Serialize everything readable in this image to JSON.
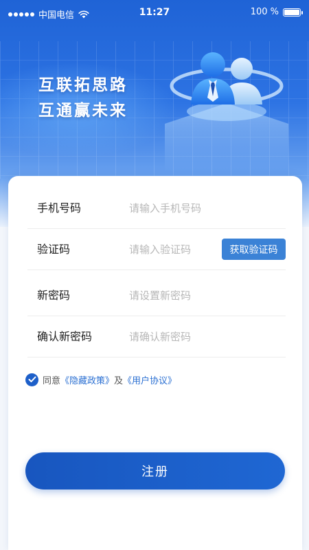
{
  "status_bar": {
    "carrier": "中国电信",
    "time": "11:27",
    "battery": "100 %"
  },
  "banner": {
    "line1": "互联拓思路",
    "line2": "互通赢未来"
  },
  "form": {
    "phone": {
      "label": "手机号码",
      "placeholder": "请输入手机号码"
    },
    "code": {
      "label": "验证码",
      "placeholder": "请输入验证码",
      "button": "获取验证码"
    },
    "password": {
      "label": "新密码",
      "placeholder": "请设置新密码"
    },
    "confirm": {
      "label": "确认新密码",
      "placeholder": "请确认新密码"
    }
  },
  "agreement": {
    "checked": true,
    "prefix": "同意",
    "privacy": "《隐藏政策》",
    "conj": "及",
    "terms": "《用户协议》"
  },
  "submit_label": "注册",
  "colors": {
    "primary": "#1d5fc9",
    "accent_button": "#3b82d6",
    "link": "#2a6fd2"
  }
}
